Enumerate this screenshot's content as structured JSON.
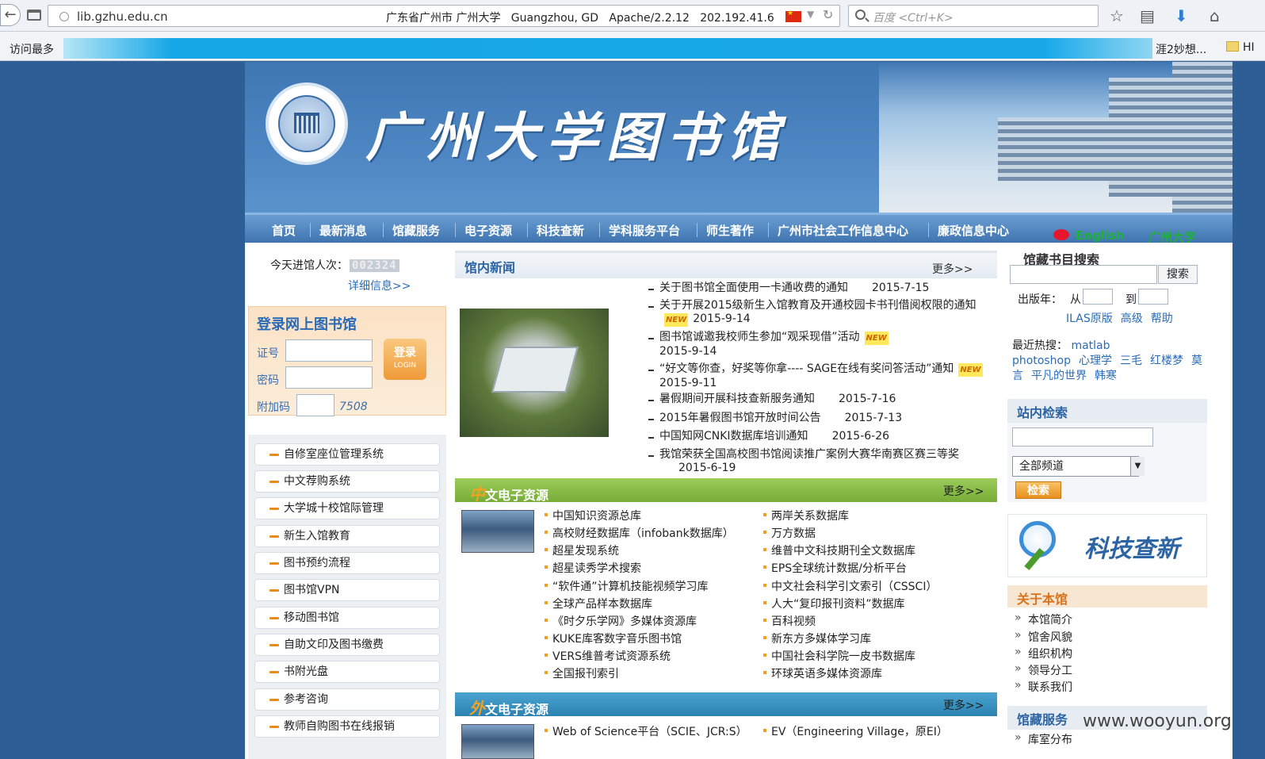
{
  "browser": {
    "url": "lib.gzhu.edu.cn",
    "site_info": "广东省广州市 广州大学   Guangzhou, GD   Apache/2.2.12   202.192.41.6",
    "search_placeholder": "百度 <Ctrl+K>",
    "bookmarks_left": "访问最多",
    "bookmarks_right": "涯2妙想...",
    "bookmarks_right2": "HI"
  },
  "header": {
    "title": "广州大学图书馆"
  },
  "nav": {
    "items": [
      "首页",
      "最新消息",
      "馆藏服务",
      "电子资源",
      "科技查新",
      "学科服务平台",
      "师生著作",
      "广州市社会工作信息中心",
      "廉政信息中心"
    ],
    "english": "English",
    "gzhu": "广州大学"
  },
  "left": {
    "visit_label": "今天进馆人次：",
    "visit_count": "002324",
    "detail_link": "详细信息>>",
    "login": {
      "title": "登录网上图书馆",
      "id_label": "证号",
      "pwd_label": "密码",
      "extra_label": "附加码",
      "button": "登录",
      "button_sub": "LOGIN",
      "captcha": "7508"
    },
    "menu": [
      "自修室座位管理系统",
      "中文荐购系统",
      "大学城十校馆际管理",
      "新生入馆教育",
      "图书预约流程",
      "图书馆VPN",
      "移动图书馆",
      "自助文印及图书缴费",
      "书附光盘",
      "参考咨询",
      "教师自购图书在线报销"
    ]
  },
  "news": {
    "title": "馆内新闻",
    "more": "更多>>",
    "new_badge": "NEW",
    "items": [
      {
        "text": "关于图书馆全面使用一卡通收费的通知",
        "date": "2015-7-15"
      },
      {
        "text": "关于开展2015级新生入馆教育及开通校园卡书刊借阅权限的通知",
        "date": "2015-9-14"
      },
      {
        "text": "图书馆诚邀我校师生参加“观采现借”活动",
        "date": "2015-9-14"
      },
      {
        "text": "“好文等你查，好奖等你拿---- SAGE在线有奖问答活动”通知",
        "date": "2015-9-11"
      },
      {
        "text": "暑假期间开展科技查新服务通知",
        "date": "2015-7-16"
      },
      {
        "text": "2015年暑假图书馆开放时间公告",
        "date": "2015-7-13"
      },
      {
        "text": "中国知网CNKI数据库培训通知",
        "date": "2015-6-26"
      },
      {
        "text": "我馆荣获全国高校图书馆阅读推广案例大赛华南赛区赛三等奖",
        "date": "2015-6-19"
      }
    ]
  },
  "cn_resources": {
    "first_char": "中",
    "title_rest": "文电子资源",
    "more": "更多>>",
    "col1": [
      "中国知识资源总库",
      "高校财经数据库（infobank数据库）",
      "超星发现系统",
      "超星读秀学术搜索",
      "“软件通”计算机技能视频学习库",
      "全球产品样本数据库",
      "《时夕乐学网》多媒体资源库",
      "KUKE库客数字音乐图书馆",
      "VERS维普考试资源系统",
      "全国报刊索引"
    ],
    "col2": [
      "两岸关系数据库",
      "万方数据",
      "维普中文科技期刊全文数据库",
      "EPS全球统计数据/分析平台",
      "中文社会科学引文索引（CSSCI）",
      "人大“复印报刊资料”数据库",
      "百科视频",
      "新东方多媒体学习库",
      "中国社会科学院一皮书数据库",
      "环球英语多媒体资源库"
    ]
  },
  "foreign_resources": {
    "first_char": "外",
    "title_rest": "文电子资源",
    "more": "更多>>",
    "col1": [
      "Web of Science平台（SCIE、JCR:S）"
    ],
    "col2": [
      "EV（Engineering Village，原EI）"
    ]
  },
  "right": {
    "catalog_title": "馆藏书目搜索",
    "catalog_button": "搜索",
    "year_label": "出版年：",
    "year_from": "从",
    "year_to": "到",
    "links": [
      "ILAS原版",
      "高级",
      "帮助"
    ],
    "hot_label": "最近热搜：",
    "hot_terms": [
      "matlab",
      "photoshop",
      "心理学",
      "三毛",
      "红楼梦",
      "莫言",
      "平凡的世界",
      "韩寒"
    ],
    "site_search_title": "站内检索",
    "site_select": "全部频道",
    "site_button": "检索",
    "kj_text": "科技查新",
    "about_title": "关于本馆",
    "about_items": [
      "本馆简介",
      "馆舍风貌",
      "组织机构",
      "领导分工",
      "联系我们"
    ],
    "service_title": "馆藏服务",
    "service_items": [
      "库室分布"
    ]
  },
  "watermark": "www.wooyun.org"
}
